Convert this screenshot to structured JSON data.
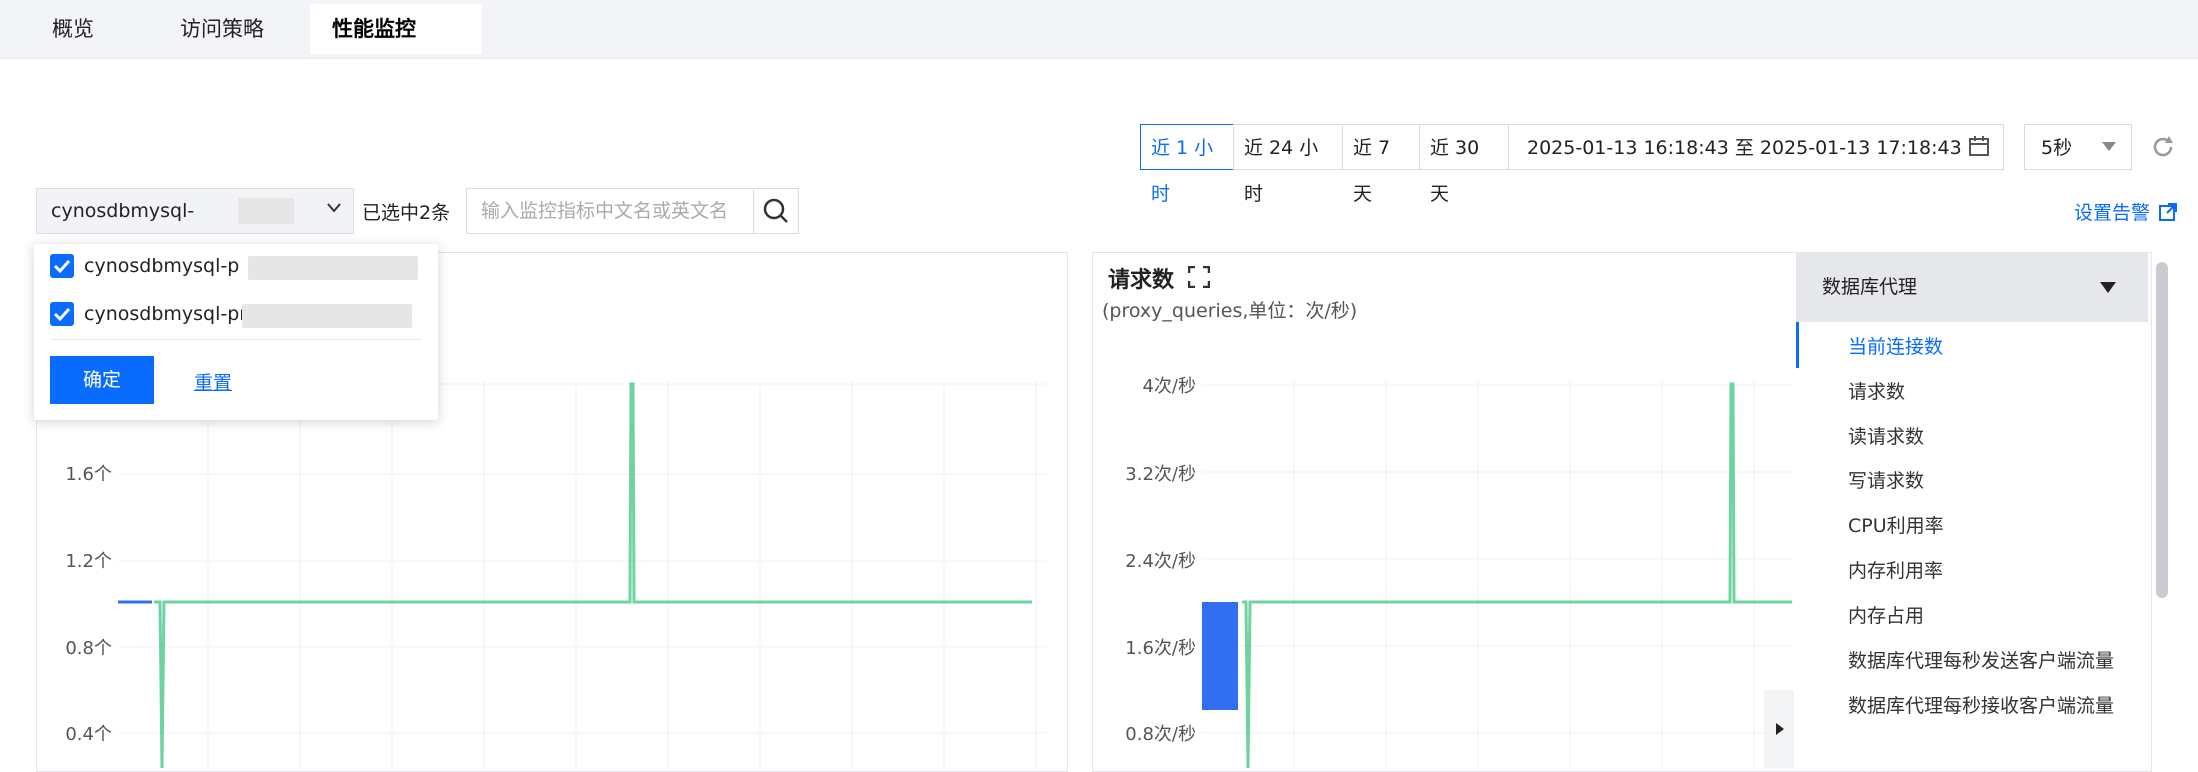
{
  "tabs": [
    {
      "label": "概览"
    },
    {
      "label": "访问策略"
    },
    {
      "label": "性能监控"
    }
  ],
  "time_range": {
    "options": [
      "近 1 小时",
      "近 24 小时",
      "近 7 天",
      "近 30 天"
    ],
    "selected": "近 1 小时",
    "date_range": "2025-01-13 16:18:43 至 2025-01-13 17:18:43",
    "refresh_interval": "5秒"
  },
  "filter": {
    "instance": "cynosdbmysql-",
    "selected_count": "已选中2条",
    "search_placeholder": "输入监控指标中文名或英文名",
    "alarm_link": "设置告警"
  },
  "dropdown": {
    "items": [
      "cynosdbmysql-p",
      "cynosdbmysql-pr"
    ],
    "confirm": "确定",
    "reset": "重置"
  },
  "chart_left": {
    "yticks": [
      "1.6个",
      "1.2个",
      "0.8个",
      "0.4个"
    ]
  },
  "chart_right": {
    "title": "请求数",
    "subtitle": "(proxy_queries,单位：次/秒)",
    "yticks": [
      "4次/秒",
      "3.2次/秒",
      "2.4次/秒",
      "1.6次/秒",
      "0.8次/秒"
    ]
  },
  "metric_menu": {
    "group": "数据库代理",
    "items": [
      "当前连接数",
      "请求数",
      "读请求数",
      "写请求数",
      "CPU利用率",
      "内存利用率",
      "内存占用",
      "数据库代理每秒发送客户端流量",
      "数据库代理每秒接收客户端流量"
    ],
    "active": "当前连接数"
  },
  "colors": {
    "primary": "#0a6cff",
    "series_green": "#6fd3a0",
    "series_blue": "#2f6ff0"
  },
  "chart_data": [
    {
      "type": "line",
      "yticks": [
        "0.4个",
        "0.8个",
        "1.2个",
        "1.6个"
      ],
      "series": [
        {
          "values": [
            1,
            1,
            0,
            1,
            1,
            1,
            1,
            2,
            1,
            1,
            1,
            1,
            1
          ]
        }
      ]
    },
    {
      "type": "line",
      "title": "请求数",
      "ylabel": "(proxy_queries,单位：次/秒)",
      "yticks": [
        "0.8次/秒",
        "1.6次/秒",
        "2.4次/秒",
        "3.2次/秒",
        "4次/秒"
      ]
    }
  ]
}
